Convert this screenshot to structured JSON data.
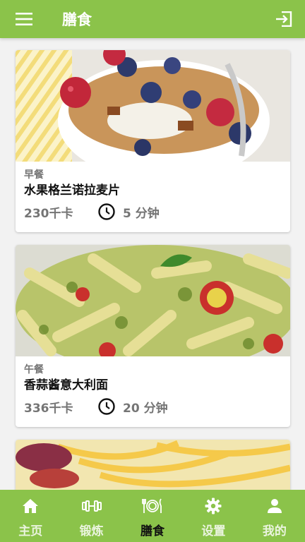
{
  "app": {
    "title": "膳食",
    "accent": "#8bc34a"
  },
  "toolbar": {
    "menu_icon": "hamburger-menu-icon",
    "exit_icon": "logout-icon"
  },
  "meals": [
    {
      "type": "早餐",
      "name": "水果格兰诺拉麦片",
      "calories": "230千卡",
      "time": "5 分钟",
      "image": "granola-fruit-bowl-photo"
    },
    {
      "type": "午餐",
      "name": "香蒜酱意大利面",
      "calories": "336千卡",
      "time": "20 分钟",
      "image": "pesto-penne-photo"
    },
    {
      "type": "",
      "name": "",
      "calories": "",
      "time": "",
      "image": "fettuccine-photo"
    }
  ],
  "nav": [
    {
      "label": "主页",
      "icon": "home-icon",
      "active": false
    },
    {
      "label": "锻炼",
      "icon": "dumbbell-icon",
      "active": false
    },
    {
      "label": "膳食",
      "icon": "plate-cutlery-icon",
      "active": true
    },
    {
      "label": "设置",
      "icon": "gear-icon",
      "active": false
    },
    {
      "label": "我的",
      "icon": "person-icon",
      "active": false
    }
  ]
}
